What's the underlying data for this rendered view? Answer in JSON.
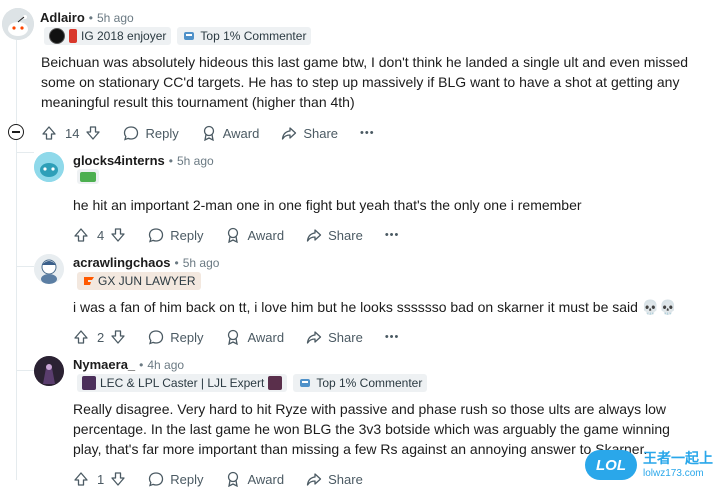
{
  "comments": [
    {
      "username": "Adlairo",
      "time": "5h ago",
      "flairs": [
        {
          "text": "IG 2018 enjoyer",
          "icon": "team-logo-icon"
        },
        {
          "text": "Top 1% Commenter",
          "icon": "trophy-icon"
        }
      ],
      "body": "Beichuan was absolutely hideous this last game btw, I don't think he landed a single ult and even missed some on stationary CC'd targets. He has to step up massively if BLG want to have a shot at getting any meaningful result this tournament (higher than 4th)",
      "votes": "14",
      "reply_label": "Reply",
      "award_label": "Award",
      "share_label": "Share",
      "more_label": "•••"
    },
    {
      "username": "glocks4interns",
      "time": "5h ago",
      "body": "he hit an important 2-man one in one fight but yeah that's the only one i remember",
      "votes": "4",
      "reply_label": "Reply",
      "award_label": "Award",
      "share_label": "Share",
      "more_label": "•••"
    },
    {
      "username": "acrawlingchaos",
      "time": "5h ago",
      "flairs": [
        {
          "text": "GX JUN LAWYER",
          "icon": "fnatic-logo-icon"
        }
      ],
      "body": "i was a fan of him back on tt, i love him but he looks sssssso bad on skarner it must be said 💀💀",
      "votes": "2",
      "reply_label": "Reply",
      "award_label": "Award",
      "share_label": "Share",
      "more_label": "•••"
    },
    {
      "username": "Nymaera_",
      "time": "4h ago",
      "flairs": [
        {
          "text": "LEC & LPL Caster | LJL Expert",
          "icon": "champion-portrait-icon"
        },
        {
          "text": "Top 1% Commenter",
          "icon": "trophy-icon"
        }
      ],
      "body": "Really disagree. Very hard to hit Ryze with passive and phase rush so those ults are always low percentage. In the last game he won BLG the 3v3 botside which was arguably the game winning play, that's far more important than missing a few Rs against an annoying answer to Skarner.",
      "votes": "1",
      "reply_label": "Reply",
      "award_label": "Award",
      "share_label": "Share",
      "more_label": "•••"
    }
  ],
  "watermark": {
    "brand": "LOL",
    "cn": "王者一起上",
    "url": "lolwz173.com"
  },
  "colors": {
    "meta": "#6b7a83",
    "flair_bg": "#eef1f3",
    "thread_line": "#e5ebee",
    "watermark_blue": "#2aa7ea"
  }
}
